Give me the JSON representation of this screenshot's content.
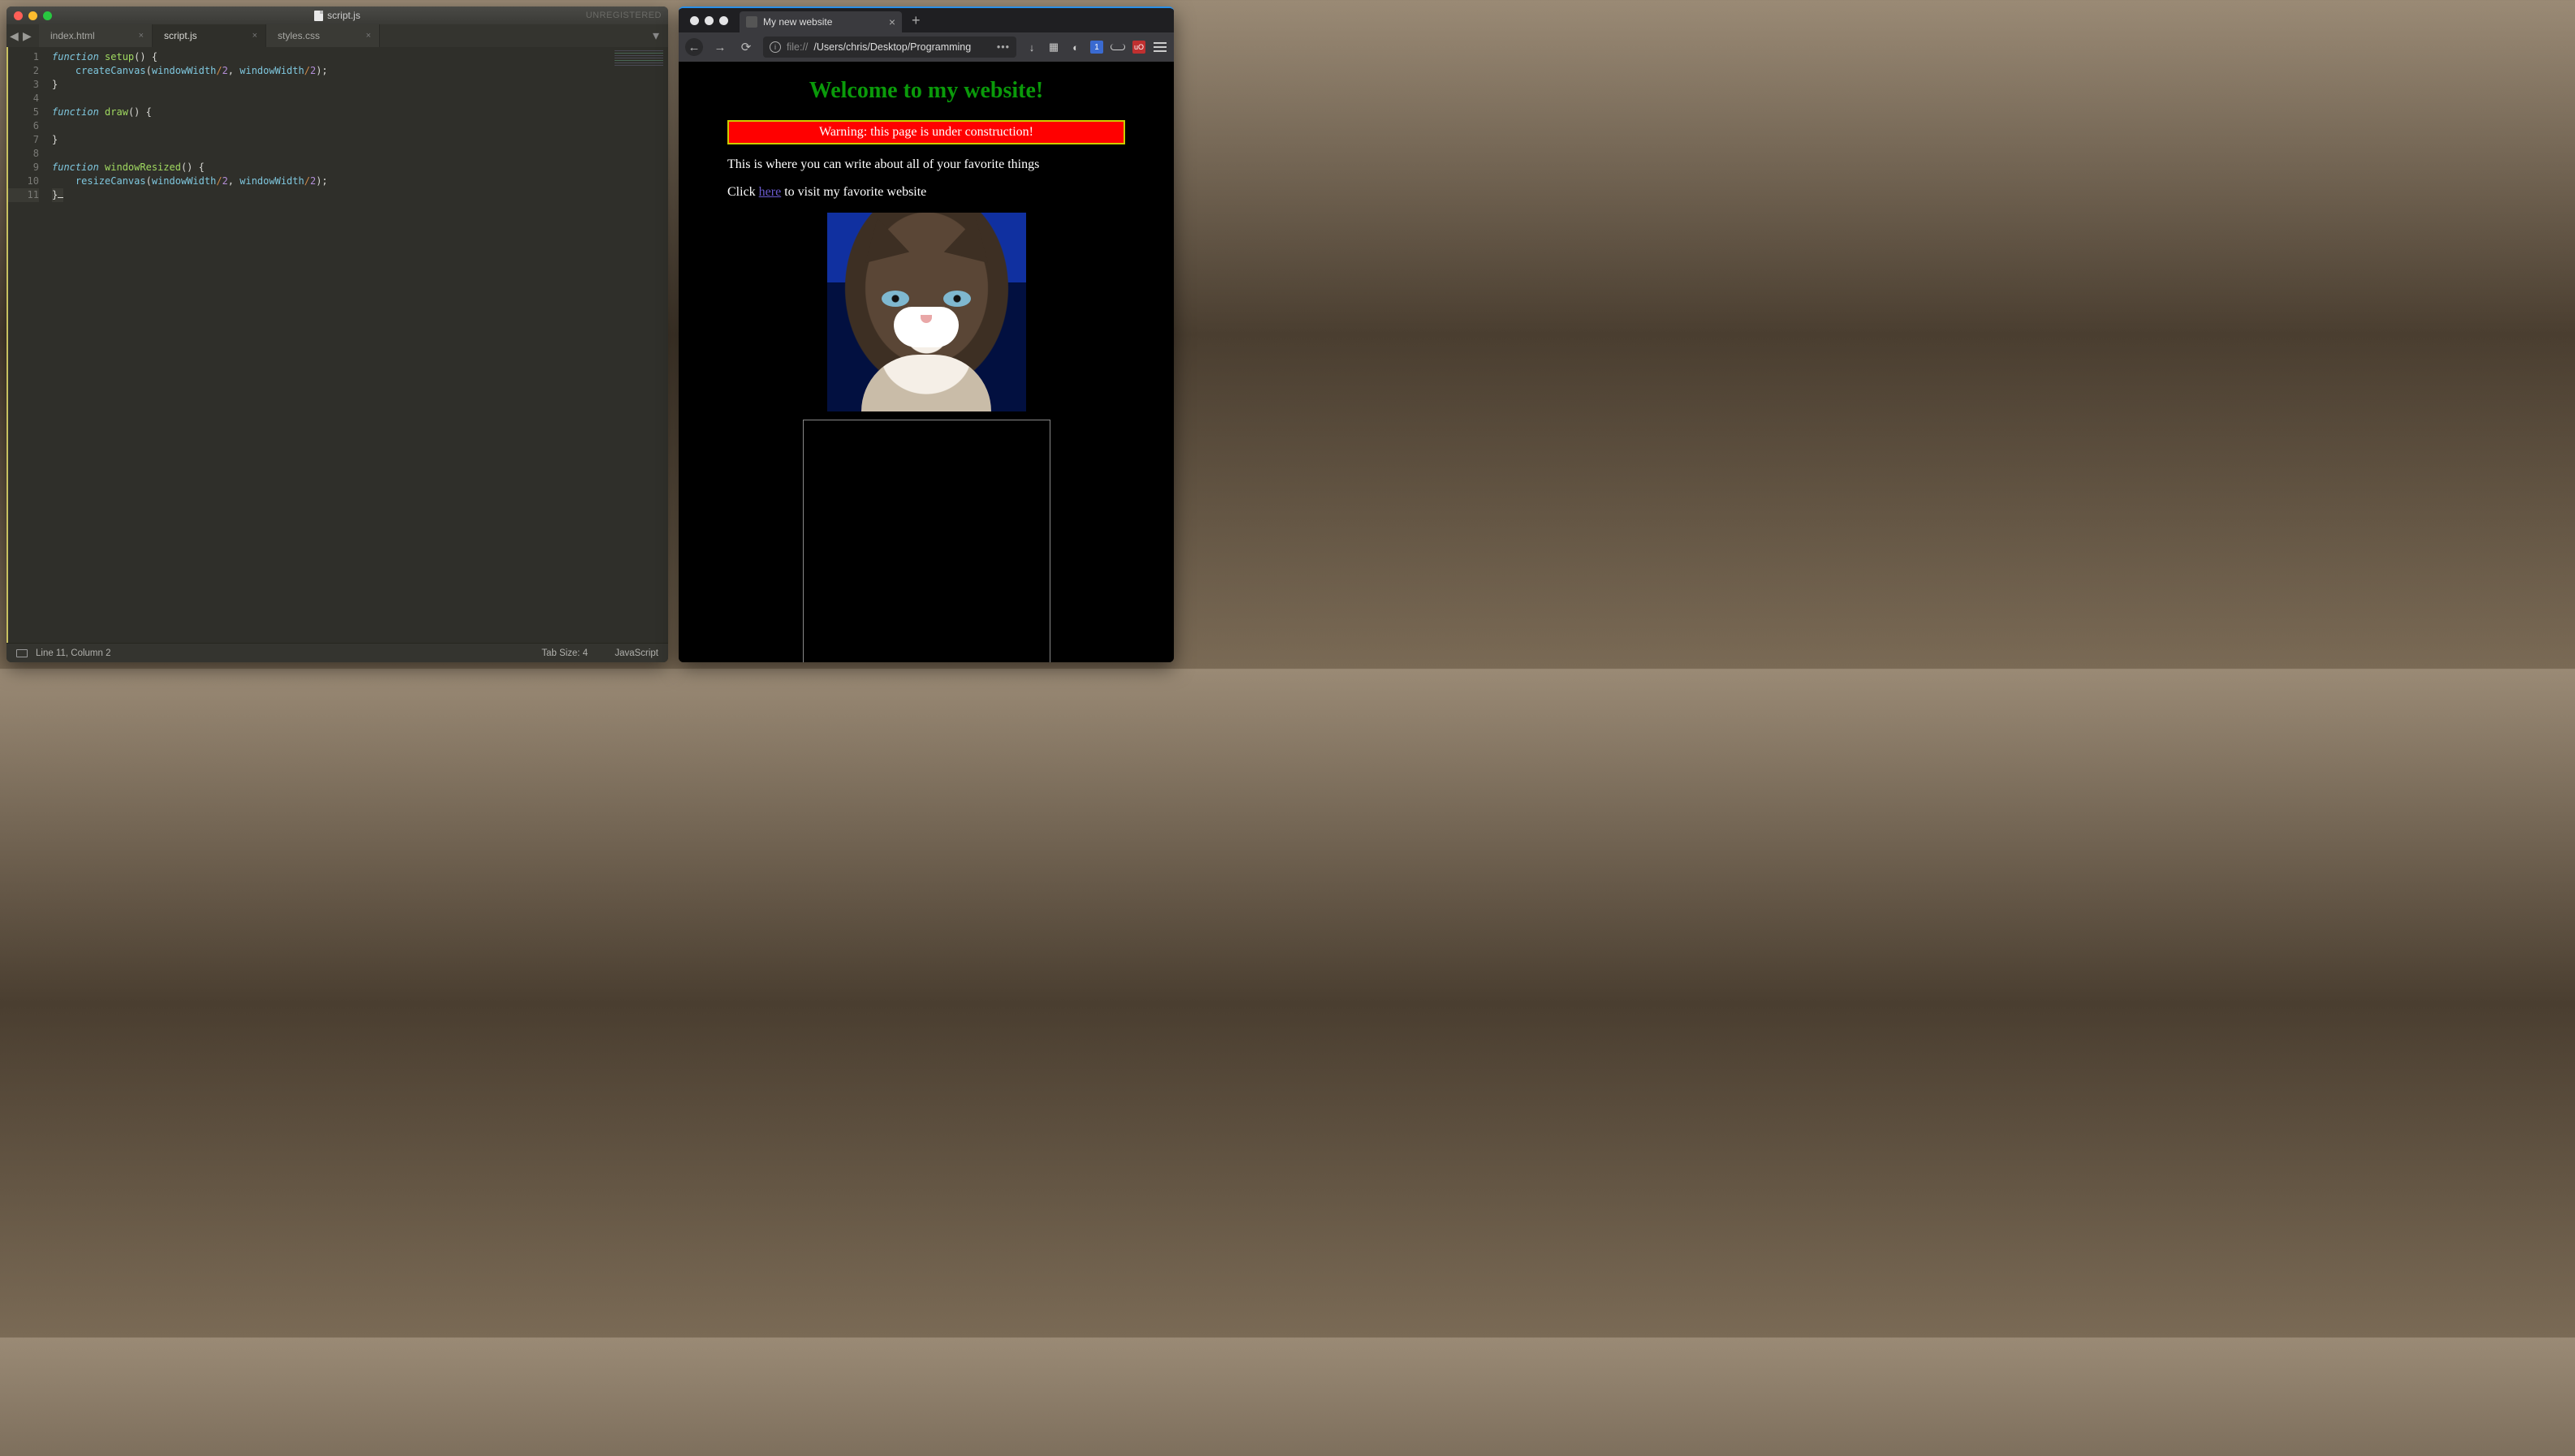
{
  "editor": {
    "title_filename": "script.js",
    "unregistered": "UNREGISTERED",
    "tabs": [
      {
        "label": "index.html",
        "active": false
      },
      {
        "label": "script.js",
        "active": true
      },
      {
        "label": "styles.css",
        "active": false
      }
    ],
    "code_lines": [
      {
        "n": 1,
        "tokens": [
          [
            "kw-it",
            "function"
          ],
          [
            "punct",
            " "
          ],
          [
            "fn-grn",
            "setup"
          ],
          [
            "punct",
            "() {"
          ]
        ]
      },
      {
        "n": 2,
        "tokens": [
          [
            "punct",
            "    "
          ],
          [
            "cls-bl",
            "createCanvas"
          ],
          [
            "punct",
            "("
          ],
          [
            "cls-bl",
            "windowWidth"
          ],
          [
            "div-op",
            "/"
          ],
          [
            "num-pur",
            "2"
          ],
          [
            "punct",
            ", "
          ],
          [
            "cls-bl",
            "windowWidth"
          ],
          [
            "div-op",
            "/"
          ],
          [
            "num-pur",
            "2"
          ],
          [
            "punct",
            ");"
          ]
        ]
      },
      {
        "n": 3,
        "tokens": [
          [
            "punct",
            "}"
          ]
        ]
      },
      {
        "n": 4,
        "tokens": [
          [
            "punct",
            ""
          ]
        ]
      },
      {
        "n": 5,
        "tokens": [
          [
            "kw-it",
            "function"
          ],
          [
            "punct",
            " "
          ],
          [
            "fn-grn",
            "draw"
          ],
          [
            "punct",
            "() {"
          ]
        ]
      },
      {
        "n": 6,
        "tokens": [
          [
            "punct",
            ""
          ]
        ]
      },
      {
        "n": 7,
        "tokens": [
          [
            "punct",
            "}"
          ]
        ]
      },
      {
        "n": 8,
        "tokens": [
          [
            "punct",
            ""
          ]
        ]
      },
      {
        "n": 9,
        "tokens": [
          [
            "kw-it",
            "function"
          ],
          [
            "punct",
            " "
          ],
          [
            "fn-grn",
            "windowResized"
          ],
          [
            "punct",
            "() {"
          ]
        ]
      },
      {
        "n": 10,
        "tokens": [
          [
            "punct",
            "    "
          ],
          [
            "cls-bl",
            "resizeCanvas"
          ],
          [
            "punct",
            "("
          ],
          [
            "cls-bl",
            "windowWidth"
          ],
          [
            "div-op",
            "/"
          ],
          [
            "num-pur",
            "2"
          ],
          [
            "punct",
            ", "
          ],
          [
            "cls-bl",
            "windowWidth"
          ],
          [
            "div-op",
            "/"
          ],
          [
            "num-pur",
            "2"
          ],
          [
            "punct",
            ");"
          ]
        ]
      },
      {
        "n": 11,
        "tokens": [
          [
            "punct",
            "}"
          ]
        ],
        "highlight": true,
        "caret_after": true
      }
    ],
    "status": {
      "position": "Line 11, Column 2",
      "tab_size": "Tab Size: 4",
      "language": "JavaScript"
    }
  },
  "browser": {
    "tab_title": "My new website",
    "url_scheme": "file://",
    "url_rest": "/Users/chris/Desktop/Programming",
    "toolbar_badge": "1",
    "shield_text": "uO",
    "page": {
      "heading": "Welcome to my website!",
      "warning": "Warning: this page is under construction!",
      "intro": "This is where you can write about all of your favorite things",
      "link_pre": "Click ",
      "link_text": "here",
      "link_post": " to visit my favorite website"
    }
  }
}
